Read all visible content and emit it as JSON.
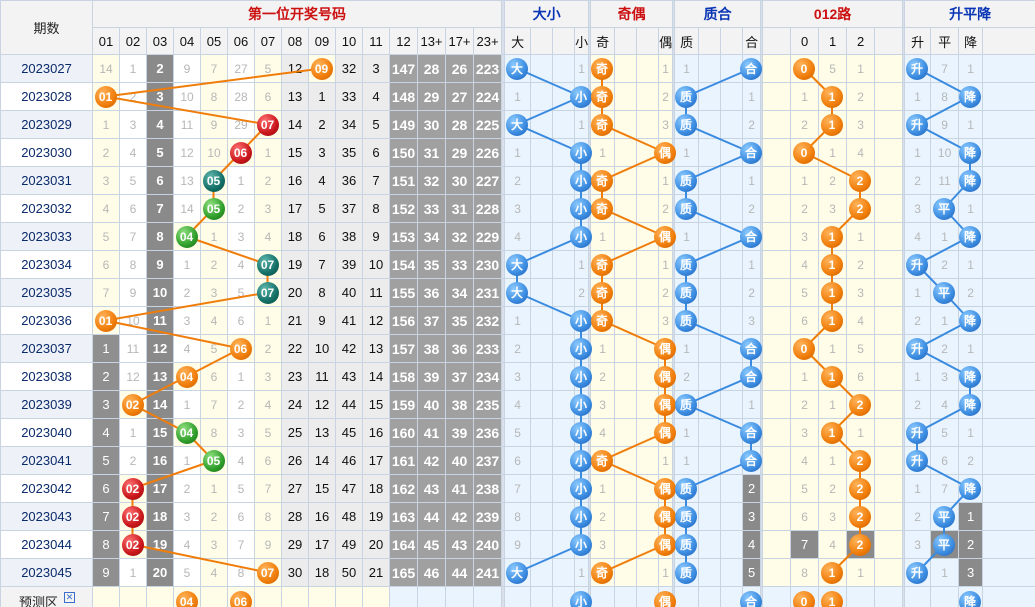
{
  "header": {
    "period_label": "期数",
    "group_titles": {
      "main": "第一位开奖号码",
      "size": "大小",
      "parity": "奇偶",
      "prime": "质合",
      "road": "012路",
      "trend": "升平降"
    },
    "columns": {
      "nums": [
        "01",
        "02",
        "03",
        "04",
        "05",
        "06",
        "07",
        "08",
        "09",
        "10",
        "11",
        "12",
        "13+",
        "17+",
        "23+"
      ],
      "size": [
        "大",
        "小"
      ],
      "parity": [
        "奇",
        "偶"
      ],
      "prime": [
        "质",
        "合"
      ],
      "road": [
        "0",
        "1",
        "2"
      ],
      "trend": [
        "升",
        "平",
        "降"
      ]
    }
  },
  "rows": [
    {
      "period": "2023027",
      "draw": "09",
      "draw_col": 9,
      "ball_color": "o",
      "miss": [
        "14",
        "1",
        "2",
        "9",
        "7",
        "27",
        "5",
        "12",
        "",
        "32",
        "3",
        "147",
        "28",
        "26",
        "223"
      ],
      "size": {
        "val": "大",
        "col": 0,
        "miss": "1"
      },
      "parity": {
        "val": "奇",
        "col": 0,
        "miss": "1"
      },
      "prime": {
        "val": "合",
        "col": 1,
        "miss": "1"
      },
      "road": {
        "val": "0",
        "col": 0,
        "miss": [
          "",
          "5",
          "1"
        ]
      },
      "trend": {
        "val": "升",
        "col": 0,
        "miss": [
          "",
          "7",
          "1"
        ]
      }
    },
    {
      "period": "2023028",
      "draw": "01",
      "draw_col": 1,
      "ball_color": "o",
      "miss": [
        "",
        "2",
        "3",
        "10",
        "8",
        "28",
        "6",
        "13",
        "1",
        "33",
        "4",
        "148",
        "29",
        "27",
        "224"
      ],
      "size": {
        "val": "小",
        "col": 1,
        "miss": "1"
      },
      "parity": {
        "val": "奇",
        "col": 0,
        "miss": "2"
      },
      "prime": {
        "val": "质",
        "col": 0,
        "miss": "1"
      },
      "road": {
        "val": "1",
        "col": 1,
        "miss": [
          "1",
          "",
          "2"
        ]
      },
      "trend": {
        "val": "降",
        "col": 2,
        "miss": [
          "1",
          "8",
          ""
        ]
      }
    },
    {
      "period": "2023029",
      "draw": "07",
      "draw_col": 7,
      "ball_color": "r",
      "miss": [
        "1",
        "3",
        "4",
        "11",
        "9",
        "29",
        "",
        "14",
        "2",
        "34",
        "5",
        "149",
        "30",
        "28",
        "225"
      ],
      "size": {
        "val": "大",
        "col": 0,
        "miss": "1"
      },
      "parity": {
        "val": "奇",
        "col": 0,
        "miss": "3"
      },
      "prime": {
        "val": "质",
        "col": 0,
        "miss": "2"
      },
      "road": {
        "val": "1",
        "col": 1,
        "miss": [
          "2",
          "",
          "3"
        ]
      },
      "trend": {
        "val": "升",
        "col": 0,
        "miss": [
          "",
          "9",
          "1"
        ]
      }
    },
    {
      "period": "2023030",
      "draw": "06",
      "draw_col": 6,
      "ball_color": "r",
      "miss": [
        "2",
        "4",
        "5",
        "12",
        "10",
        "",
        "1",
        "15",
        "3",
        "35",
        "6",
        "150",
        "31",
        "29",
        "226"
      ],
      "size": {
        "val": "小",
        "col": 1,
        "miss": "1"
      },
      "parity": {
        "val": "偶",
        "col": 1,
        "miss": "1"
      },
      "prime": {
        "val": "合",
        "col": 1,
        "miss": "1"
      },
      "road": {
        "val": "0",
        "col": 0,
        "miss": [
          "",
          "1",
          "4"
        ]
      },
      "trend": {
        "val": "降",
        "col": 2,
        "miss": [
          "1",
          "10",
          ""
        ]
      }
    },
    {
      "period": "2023031",
      "draw": "05",
      "draw_col": 5,
      "ball_color": "t",
      "miss": [
        "3",
        "5",
        "6",
        "13",
        "",
        "1",
        "2",
        "16",
        "4",
        "36",
        "7",
        "151",
        "32",
        "30",
        "227"
      ],
      "size": {
        "val": "小",
        "col": 1,
        "miss": "2"
      },
      "parity": {
        "val": "奇",
        "col": 0,
        "miss": "1"
      },
      "prime": {
        "val": "质",
        "col": 0,
        "miss": "1"
      },
      "road": {
        "val": "2",
        "col": 2,
        "miss": [
          "1",
          "2",
          ""
        ]
      },
      "trend": {
        "val": "降",
        "col": 2,
        "miss": [
          "2",
          "11",
          ""
        ]
      }
    },
    {
      "period": "2023032",
      "draw": "05",
      "draw_col": 5,
      "ball_color": "g",
      "miss": [
        "4",
        "6",
        "7",
        "14",
        "",
        "2",
        "3",
        "17",
        "5",
        "37",
        "8",
        "152",
        "33",
        "31",
        "228"
      ],
      "size": {
        "val": "小",
        "col": 1,
        "miss": "3"
      },
      "parity": {
        "val": "奇",
        "col": 0,
        "miss": "2"
      },
      "prime": {
        "val": "质",
        "col": 0,
        "miss": "2"
      },
      "road": {
        "val": "2",
        "col": 2,
        "miss": [
          "2",
          "3",
          ""
        ]
      },
      "trend": {
        "val": "平",
        "col": 1,
        "miss": [
          "3",
          "",
          "1"
        ]
      }
    },
    {
      "period": "2023033",
      "draw": "04",
      "draw_col": 4,
      "ball_color": "g",
      "miss": [
        "5",
        "7",
        "8",
        "",
        "1",
        "3",
        "4",
        "18",
        "6",
        "38",
        "9",
        "153",
        "34",
        "32",
        "229"
      ],
      "size": {
        "val": "小",
        "col": 1,
        "miss": "4"
      },
      "parity": {
        "val": "偶",
        "col": 1,
        "miss": "1"
      },
      "prime": {
        "val": "合",
        "col": 1,
        "miss": "1"
      },
      "road": {
        "val": "1",
        "col": 1,
        "miss": [
          "3",
          "",
          "1"
        ]
      },
      "trend": {
        "val": "降",
        "col": 2,
        "miss": [
          "4",
          "1",
          ""
        ]
      }
    },
    {
      "period": "2023034",
      "draw": "07",
      "draw_col": 7,
      "ball_color": "t",
      "miss": [
        "6",
        "8",
        "9",
        "1",
        "2",
        "4",
        "",
        "19",
        "7",
        "39",
        "10",
        "154",
        "35",
        "33",
        "230"
      ],
      "size": {
        "val": "大",
        "col": 0,
        "miss": "1"
      },
      "parity": {
        "val": "奇",
        "col": 0,
        "miss": "1"
      },
      "prime": {
        "val": "质",
        "col": 0,
        "miss": "1"
      },
      "road": {
        "val": "1",
        "col": 1,
        "miss": [
          "4",
          "",
          "2"
        ]
      },
      "trend": {
        "val": "升",
        "col": 0,
        "miss": [
          "",
          "2",
          "1"
        ]
      }
    },
    {
      "period": "2023035",
      "draw": "07",
      "draw_col": 7,
      "ball_color": "t",
      "miss": [
        "7",
        "9",
        "10",
        "2",
        "3",
        "5",
        "",
        "20",
        "8",
        "40",
        "11",
        "155",
        "36",
        "34",
        "231"
      ],
      "size": {
        "val": "大",
        "col": 0,
        "miss": "2"
      },
      "parity": {
        "val": "奇",
        "col": 0,
        "miss": "2"
      },
      "prime": {
        "val": "质",
        "col": 0,
        "miss": "2"
      },
      "road": {
        "val": "1",
        "col": 1,
        "miss": [
          "5",
          "",
          "3"
        ]
      },
      "trend": {
        "val": "平",
        "col": 1,
        "miss": [
          "1",
          "",
          "2"
        ]
      }
    },
    {
      "period": "2023036",
      "draw": "01",
      "draw_col": 1,
      "ball_color": "o",
      "miss": [
        "",
        "10",
        "11",
        "3",
        "4",
        "6",
        "1",
        "21",
        "9",
        "41",
        "12",
        "156",
        "37",
        "35",
        "232"
      ],
      "size": {
        "val": "小",
        "col": 1,
        "miss": "1"
      },
      "parity": {
        "val": "奇",
        "col": 0,
        "miss": "3"
      },
      "prime": {
        "val": "质",
        "col": 0,
        "miss": "3"
      },
      "road": {
        "val": "1",
        "col": 1,
        "miss": [
          "6",
          "",
          "4"
        ]
      },
      "trend": {
        "val": "降",
        "col": 2,
        "miss": [
          "2",
          "1",
          ""
        ]
      }
    },
    {
      "period": "2023037",
      "draw": "06",
      "draw_col": 6,
      "ball_color": "o",
      "miss": [
        "1",
        "11",
        "12",
        "4",
        "5",
        "",
        "2",
        "22",
        "10",
        "42",
        "13",
        "157",
        "38",
        "36",
        "233"
      ],
      "size": {
        "val": "小",
        "col": 1,
        "miss": "2"
      },
      "parity": {
        "val": "偶",
        "col": 1,
        "miss": "1"
      },
      "prime": {
        "val": "合",
        "col": 1,
        "miss": "1"
      },
      "road": {
        "val": "0",
        "col": 0,
        "miss": [
          "",
          "1",
          "5"
        ]
      },
      "trend": {
        "val": "升",
        "col": 0,
        "miss": [
          "",
          "2",
          "1"
        ]
      }
    },
    {
      "period": "2023038",
      "draw": "04",
      "draw_col": 4,
      "ball_color": "o",
      "miss": [
        "2",
        "12",
        "13",
        "",
        "6",
        "1",
        "3",
        "23",
        "11",
        "43",
        "14",
        "158",
        "39",
        "37",
        "234"
      ],
      "size": {
        "val": "小",
        "col": 1,
        "miss": "3"
      },
      "parity": {
        "val": "偶",
        "col": 1,
        "miss": "2"
      },
      "prime": {
        "val": "合",
        "col": 1,
        "miss": "2"
      },
      "road": {
        "val": "1",
        "col": 1,
        "miss": [
          "1",
          "",
          "6"
        ]
      },
      "trend": {
        "val": "降",
        "col": 2,
        "miss": [
          "1",
          "3",
          ""
        ]
      }
    },
    {
      "period": "2023039",
      "draw": "02",
      "draw_col": 2,
      "ball_color": "o",
      "miss": [
        "3",
        "",
        "14",
        "1",
        "7",
        "2",
        "4",
        "24",
        "12",
        "44",
        "15",
        "159",
        "40",
        "38",
        "235"
      ],
      "size": {
        "val": "小",
        "col": 1,
        "miss": "4"
      },
      "parity": {
        "val": "偶",
        "col": 1,
        "miss": "3"
      },
      "prime": {
        "val": "质",
        "col": 0,
        "miss": "1"
      },
      "road": {
        "val": "2",
        "col": 2,
        "miss": [
          "2",
          "1",
          ""
        ]
      },
      "trend": {
        "val": "降",
        "col": 2,
        "miss": [
          "2",
          "4",
          ""
        ]
      }
    },
    {
      "period": "2023040",
      "draw": "04",
      "draw_col": 4,
      "ball_color": "g",
      "miss": [
        "4",
        "1",
        "15",
        "",
        "8",
        "3",
        "5",
        "25",
        "13",
        "45",
        "16",
        "160",
        "41",
        "39",
        "236"
      ],
      "size": {
        "val": "小",
        "col": 1,
        "miss": "5"
      },
      "parity": {
        "val": "偶",
        "col": 1,
        "miss": "4"
      },
      "prime": {
        "val": "合",
        "col": 1,
        "miss": "1"
      },
      "road": {
        "val": "1",
        "col": 1,
        "miss": [
          "3",
          "",
          "1"
        ]
      },
      "trend": {
        "val": "升",
        "col": 0,
        "miss": [
          "",
          "5",
          "1"
        ]
      }
    },
    {
      "period": "2023041",
      "draw": "05",
      "draw_col": 5,
      "ball_color": "g",
      "miss": [
        "5",
        "2",
        "16",
        "1",
        "",
        "4",
        "6",
        "26",
        "14",
        "46",
        "17",
        "161",
        "42",
        "40",
        "237"
      ],
      "size": {
        "val": "小",
        "col": 1,
        "miss": "6"
      },
      "parity": {
        "val": "奇",
        "col": 0,
        "miss": "1"
      },
      "prime": {
        "val": "合",
        "col": 1,
        "miss": "1"
      },
      "road": {
        "val": "2",
        "col": 2,
        "miss": [
          "4",
          "1",
          ""
        ]
      },
      "trend": {
        "val": "升",
        "col": 0,
        "miss": [
          "",
          "6",
          "2"
        ]
      }
    },
    {
      "period": "2023042",
      "draw": "02",
      "draw_col": 2,
      "ball_color": "r",
      "miss": [
        "6",
        "",
        "17",
        "2",
        "1",
        "5",
        "7",
        "27",
        "15",
        "47",
        "18",
        "162",
        "43",
        "41",
        "238"
      ],
      "size": {
        "val": "小",
        "col": 1,
        "miss": "7"
      },
      "parity": {
        "val": "偶",
        "col": 1,
        "miss": "1"
      },
      "prime": {
        "val": "质",
        "col": 0,
        "miss": "2"
      },
      "road": {
        "val": "2",
        "col": 2,
        "miss": [
          "5",
          "2",
          ""
        ]
      },
      "trend": {
        "val": "降",
        "col": 2,
        "miss": [
          "1",
          "7",
          ""
        ]
      }
    },
    {
      "period": "2023043",
      "draw": "02",
      "draw_col": 2,
      "ball_color": "r",
      "miss": [
        "7",
        "",
        "18",
        "3",
        "2",
        "6",
        "8",
        "28",
        "16",
        "48",
        "19",
        "163",
        "44",
        "42",
        "239"
      ],
      "size": {
        "val": "小",
        "col": 1,
        "miss": "8"
      },
      "parity": {
        "val": "偶",
        "col": 1,
        "miss": "2"
      },
      "prime": {
        "val": "质",
        "col": 0,
        "miss": "3"
      },
      "road": {
        "val": "2",
        "col": 2,
        "miss": [
          "6",
          "3",
          ""
        ]
      },
      "trend": {
        "val": "平",
        "col": 1,
        "miss": [
          "2",
          "",
          "1"
        ]
      }
    },
    {
      "period": "2023044",
      "draw": "02",
      "draw_col": 2,
      "ball_color": "r",
      "miss": [
        "8",
        "",
        "19",
        "4",
        "3",
        "7",
        "9",
        "29",
        "17",
        "49",
        "20",
        "164",
        "45",
        "43",
        "240"
      ],
      "size": {
        "val": "小",
        "col": 1,
        "miss": "9"
      },
      "parity": {
        "val": "偶",
        "col": 1,
        "miss": "3"
      },
      "prime": {
        "val": "质",
        "col": 0,
        "miss": "4"
      },
      "road": {
        "val": "2",
        "col": 2,
        "miss": [
          "7",
          "4",
          ""
        ]
      },
      "trend": {
        "val": "平",
        "col": 1,
        "miss": [
          "3",
          "",
          "2"
        ]
      }
    },
    {
      "period": "2023045",
      "draw": "07",
      "draw_col": 7,
      "ball_color": "o",
      "miss": [
        "9",
        "1",
        "20",
        "5",
        "4",
        "8",
        "",
        "30",
        "18",
        "50",
        "21",
        "165",
        "46",
        "44",
        "241"
      ],
      "size": {
        "val": "大",
        "col": 0,
        "miss": "1"
      },
      "parity": {
        "val": "奇",
        "col": 0,
        "miss": "1"
      },
      "prime": {
        "val": "质",
        "col": 0,
        "miss": "5"
      },
      "road": {
        "val": "1",
        "col": 1,
        "miss": [
          "8",
          "",
          "1"
        ]
      },
      "trend": {
        "val": "升",
        "col": 0,
        "miss": [
          "",
          "1",
          "3"
        ]
      }
    }
  ],
  "prediction": {
    "label": "预测区",
    "close_glyph": "✕",
    "balls": [
      {
        "text": "04",
        "col": 4,
        "group": "nums"
      },
      {
        "text": "06",
        "col": 6,
        "group": "nums"
      },
      {
        "text": "小",
        "col": 1,
        "group": "size"
      },
      {
        "text": "偶",
        "col": 1,
        "group": "parity"
      },
      {
        "text": "合",
        "col": 1,
        "group": "prime"
      },
      {
        "text": "0",
        "col": 0,
        "group": "road"
      },
      {
        "text": "1",
        "col": 1,
        "group": "road"
      },
      {
        "text": "降",
        "col": 2,
        "group": "trend"
      }
    ]
  },
  "colors": {
    "num_line": "#f07d0a",
    "size_line": "#3a8be0",
    "parity_line": "#f07d0a",
    "prime_line": "#3a8be0",
    "road_line": "#f07d0a",
    "trend_line": "#3a8be0"
  }
}
